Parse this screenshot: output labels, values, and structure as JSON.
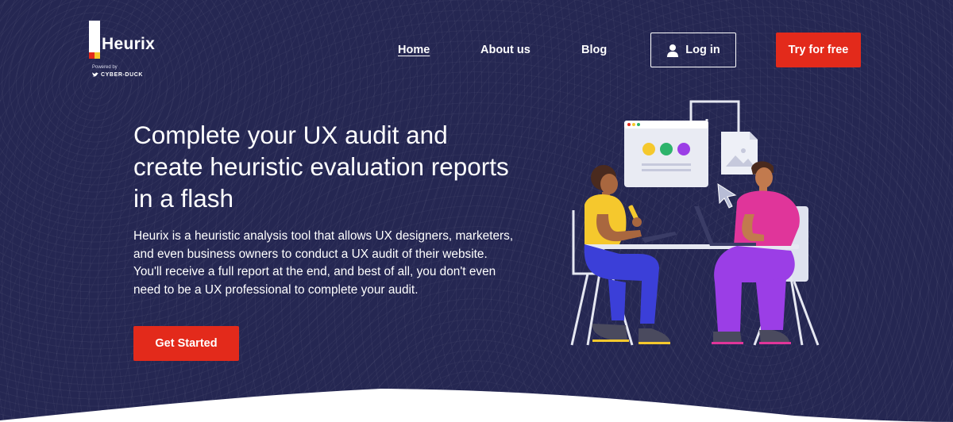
{
  "brand": {
    "name": "Heurix",
    "powered_by": "Powered by",
    "partner": "CYBER-DUCK"
  },
  "nav": {
    "home": "Home",
    "about": "About us",
    "blog": "Blog",
    "login": "Log in",
    "try_free": "Try for free"
  },
  "hero": {
    "title": "Complete your UX audit and create heuristic evaluation reports in a flash",
    "description": "Heurix is a heuristic analysis tool that allows UX designers, marketers, and even business owners to conduct a UX audit of their website. You'll receive a full report at the end, and best of all, you don't even need to be a UX professional to complete your audit.",
    "cta": "Get Started"
  },
  "colors": {
    "background": "#252752",
    "accent_red": "#e32a1b",
    "yellow": "#f5c82d",
    "green": "#2db36b",
    "purple": "#9b3ee6",
    "pink": "#e0359a",
    "blue": "#3b3fd8"
  },
  "icons": {
    "login": "user-icon",
    "twitter": "bird-icon"
  }
}
